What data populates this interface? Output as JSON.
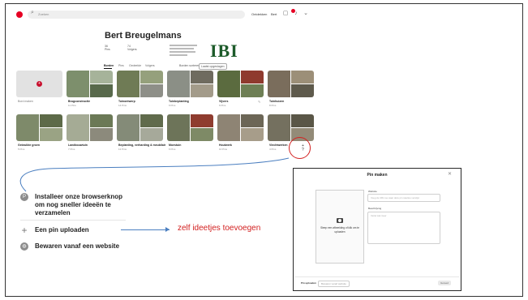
{
  "board": {
    "search_placeholder": "Zoeken",
    "topbar": {
      "home": "Ontdekken",
      "profile": "Bert"
    },
    "title": "Bert Breugelmans",
    "stats": [
      {
        "num": "36",
        "label": "Pins"
      },
      {
        "num": "74",
        "label": "Volgers"
      }
    ],
    "logo_text": "IBI",
    "tabs": [
      "Borden",
      "Pins",
      "Gedeelde",
      "Volgers"
    ],
    "sort": {
      "label": "Borden sorteren",
      "value": "Laatst opgeslagen"
    },
    "tiles_row1": [
      {
        "label": "Bord maken",
        "sub": ""
      },
      {
        "label": "Brugconstructie",
        "sub": "11 Pins"
      },
      {
        "label": "Tuinontwerp",
        "sub": "14 Pins"
      },
      {
        "label": "Tuinbeplanting",
        "sub": "9 Pins"
      },
      {
        "label": "Vijvers",
        "sub": "6 Pins"
      },
      {
        "label": "Tuinhuizen",
        "sub": "8 Pins"
      }
    ],
    "tiles_row2": [
      {
        "label": "Gebruikte groen",
        "sub": "5 Pins"
      },
      {
        "label": "Landbouwtuin",
        "sub": "7 Pins"
      },
      {
        "label": "Beplanting, verharding & meubilair",
        "sub": "12 Pins"
      },
      {
        "label": "Moestuin",
        "sub": "6 Pins"
      },
      {
        "label": "Houtwerk",
        "sub": "10 Pins"
      },
      {
        "label": "Vlechtwerken",
        "sub": "4 Pins"
      }
    ]
  },
  "menu": {
    "items": [
      {
        "icon": "pinterest-icon",
        "label": "Installeer onze browserknop om nog sneller ideeën te verzamelen"
      },
      {
        "icon": "plus-icon",
        "label": "Een pin uploaden"
      },
      {
        "icon": "globe-icon",
        "label": "Bewaren vanaf een website"
      }
    ]
  },
  "annotation": "zelf ideetjes toevoegen",
  "dialog": {
    "title": "Pin maken",
    "upload_text": "Sleep een afbeelding of klik om te uploaden",
    "website_label": "Website",
    "website_placeholder": "Voeg de URL toe waar deze pin naartoe verwijst",
    "description_label": "Beschrijving",
    "description_placeholder": "Vertel wat meer",
    "bottom": {
      "upload_tab": "Pin uploaden",
      "website_tab": "Bewaren vanaf website",
      "done": "Gereed"
    }
  },
  "colors": {
    "pinterest_red": "#e60023",
    "annotation_red": "#d21f1f",
    "arrow_blue": "#4b7fc0",
    "logo_green": "#1d5b2a"
  }
}
